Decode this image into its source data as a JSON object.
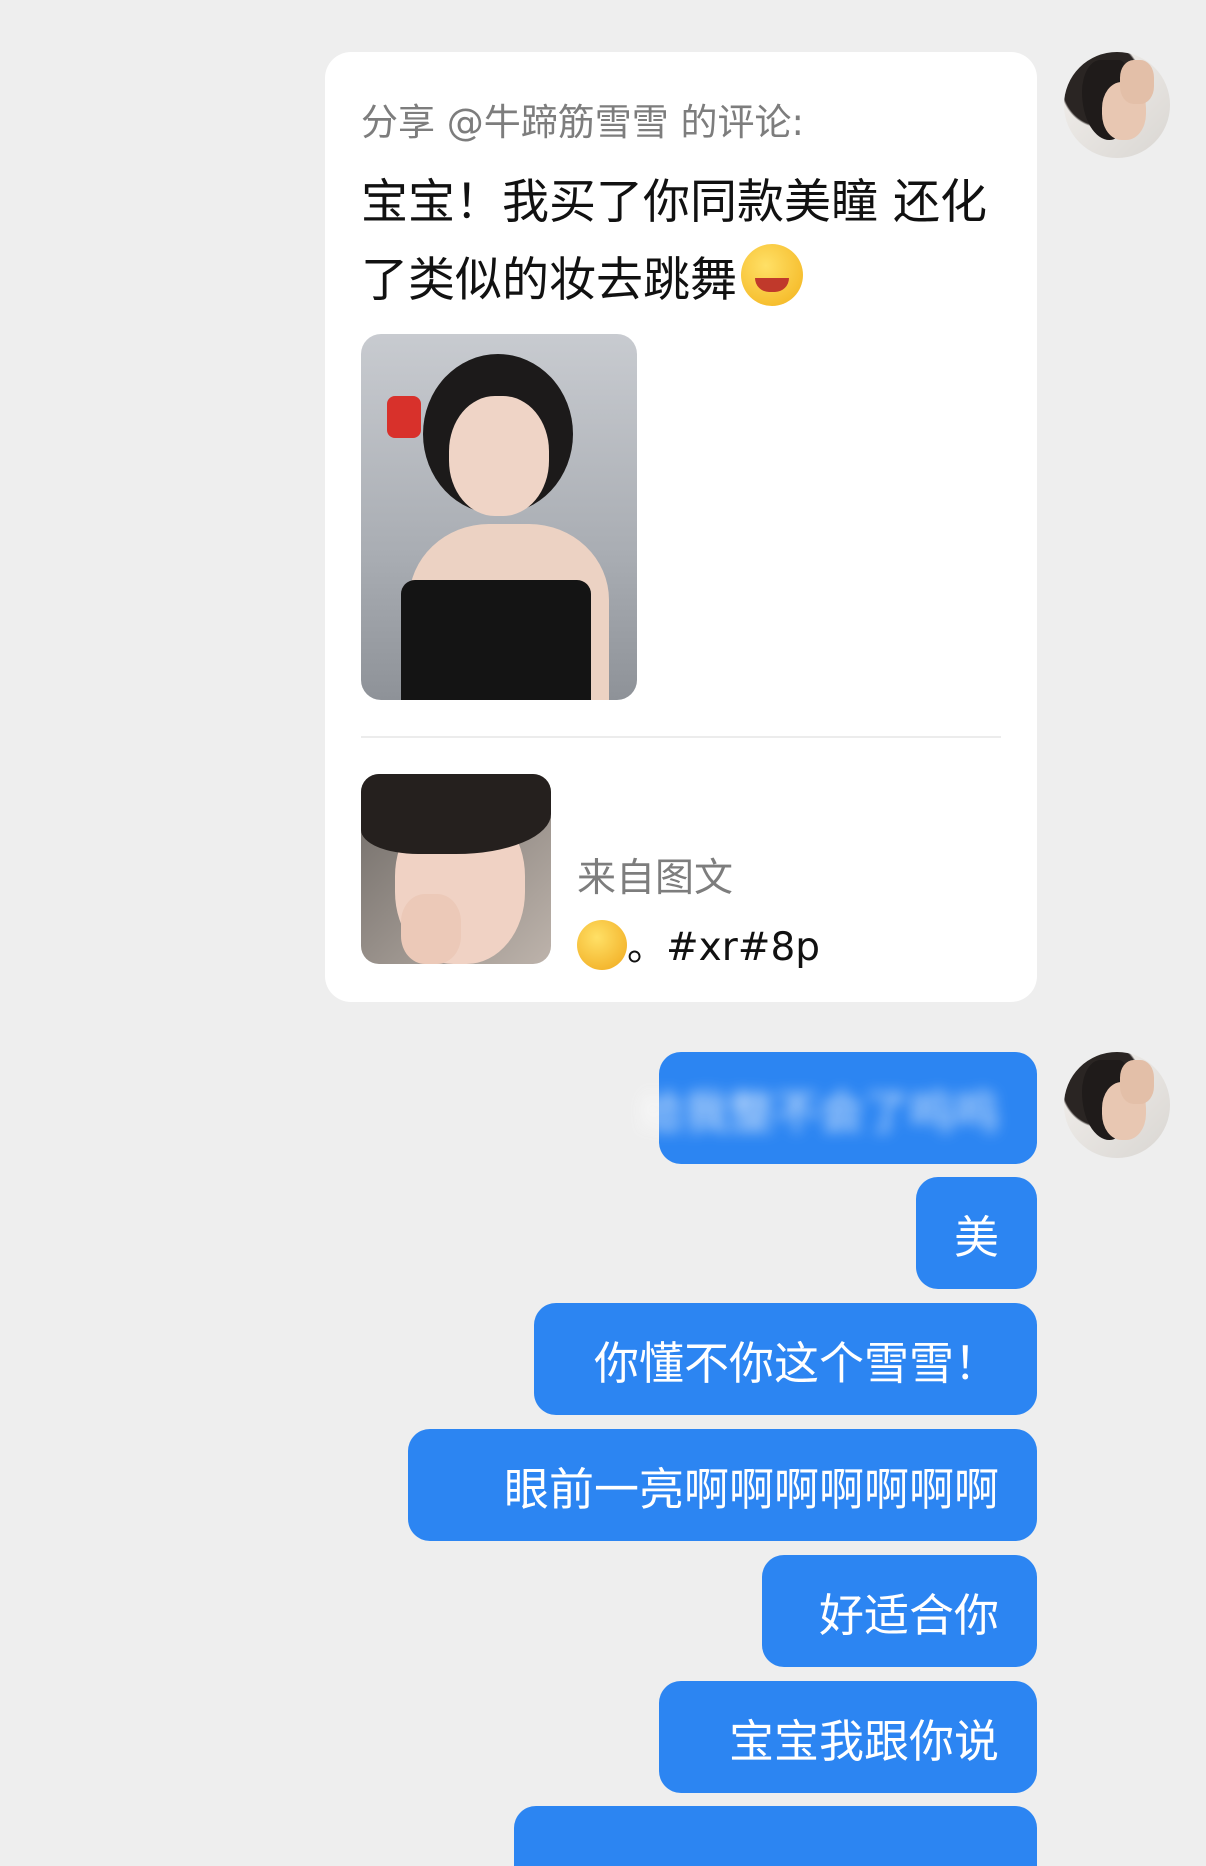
{
  "shared_card": {
    "header": "分享 @牛蹄筋雪雪 的评论:",
    "comment_text": "宝宝！我买了你同款美瞳 还化了类似的妆去跳舞",
    "comment_emoji": "wink-face-emoji",
    "source_label": "来自图文",
    "source_desc": "。#xr#8p",
    "source_emoji": "thinking-face-emoji"
  },
  "messages": [
    {
      "text": "给我整不会了呜呜",
      "blurred": true
    },
    {
      "text": "美",
      "blurred": false
    },
    {
      "text": "你懂不你这个雪雪！",
      "blurred": false
    },
    {
      "text": "眼前一亮啊啊啊啊啊啊啊",
      "blurred": false
    },
    {
      "text": "好适合你",
      "blurred": false
    },
    {
      "text": "宝宝我跟你说",
      "blurred": false
    }
  ],
  "colors": {
    "background": "#eeeeee",
    "bubble": "#2c85f2",
    "card": "#ffffff"
  }
}
